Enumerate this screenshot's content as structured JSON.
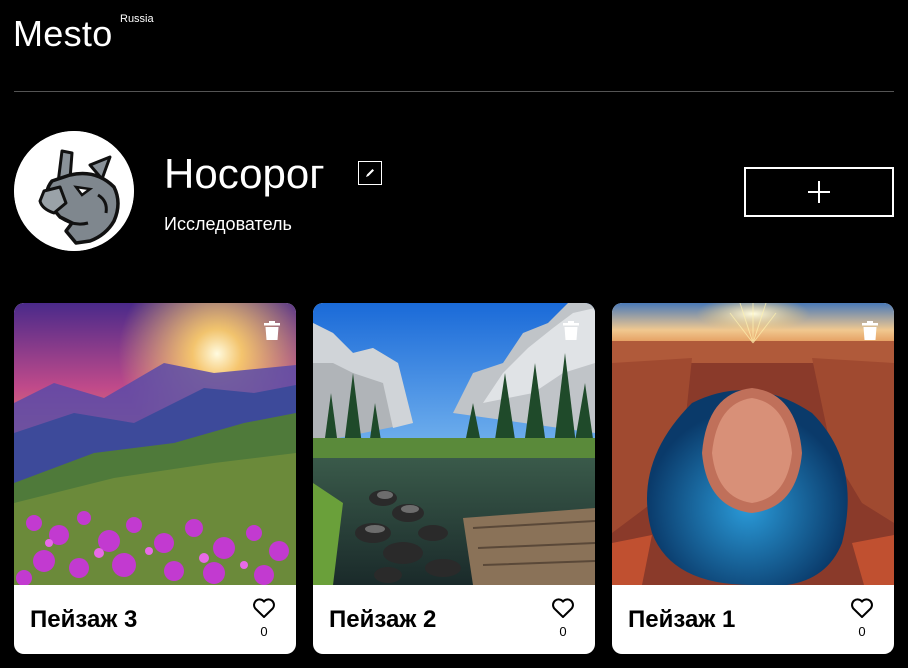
{
  "header": {
    "logo": "Mesto",
    "logo_sup": "Russia"
  },
  "profile": {
    "name": "Носорог",
    "about": "Исследователь",
    "avatar_icon": "rhino-avatar-icon",
    "edit_icon": "pencil-icon",
    "add_icon": "plus-icon"
  },
  "cards": [
    {
      "title": "Пейзаж 3",
      "likes": "0",
      "scene": "sunset-mountain-meadow-with-pink-flowers"
    },
    {
      "title": "Пейзаж 2",
      "likes": "0",
      "scene": "yosemite-valley-river-with-granite-cliffs"
    },
    {
      "title": "Пейзаж 1",
      "likes": "0",
      "scene": "horseshoe-bend-canyon-at-sunset"
    }
  ],
  "colors": {
    "background": "#000000",
    "card": "#ffffff",
    "divider": "#545454"
  }
}
